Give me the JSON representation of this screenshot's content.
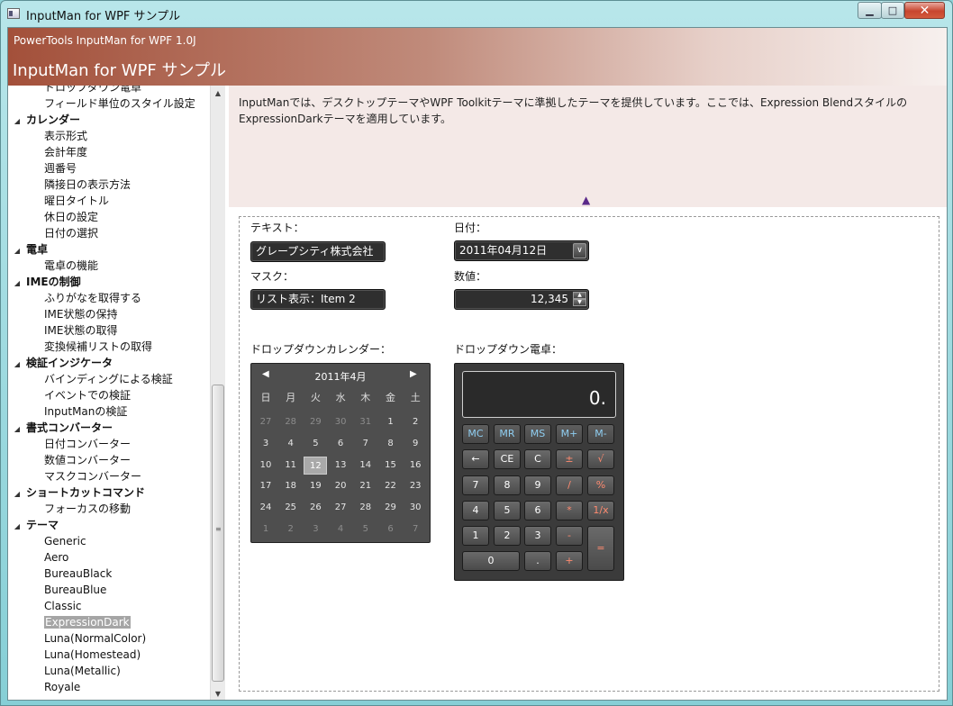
{
  "window": {
    "title": "InputMan for WPF サンプル",
    "minimize_label": "▁",
    "maximize_label": "□",
    "close_label": "✕"
  },
  "header": {
    "subtitle": "PowerTools InputMan for WPF 1.0J",
    "title": "InputMan for WPF サンプル"
  },
  "sidebar": {
    "rows": [
      {
        "label": "ドロップダウン電卓",
        "kind": "item"
      },
      {
        "label": "フィールド単位のスタイル設定",
        "kind": "item"
      },
      {
        "label": "カレンダー",
        "kind": "cat"
      },
      {
        "label": "表示形式",
        "kind": "item"
      },
      {
        "label": "会計年度",
        "kind": "item"
      },
      {
        "label": "週番号",
        "kind": "item"
      },
      {
        "label": "隣接日の表示方法",
        "kind": "item"
      },
      {
        "label": "曜日タイトル",
        "kind": "item"
      },
      {
        "label": "休日の設定",
        "kind": "item"
      },
      {
        "label": "日付の選択",
        "kind": "item"
      },
      {
        "label": "電卓",
        "kind": "cat"
      },
      {
        "label": "電卓の機能",
        "kind": "item"
      },
      {
        "label": "IMEの制御",
        "kind": "cat"
      },
      {
        "label": "ふりがなを取得する",
        "kind": "item"
      },
      {
        "label": "IME状態の保持",
        "kind": "item"
      },
      {
        "label": "IME状態の取得",
        "kind": "item"
      },
      {
        "label": "変換候補リストの取得",
        "kind": "item"
      },
      {
        "label": "検証インジケータ",
        "kind": "cat"
      },
      {
        "label": "バインディングによる検証",
        "kind": "item"
      },
      {
        "label": "イベントでの検証",
        "kind": "item"
      },
      {
        "label": "InputManの検証",
        "kind": "item"
      },
      {
        "label": "書式コンバーター",
        "kind": "cat"
      },
      {
        "label": "日付コンバーター",
        "kind": "item"
      },
      {
        "label": "数値コンバーター",
        "kind": "item"
      },
      {
        "label": "マスクコンバーター",
        "kind": "item"
      },
      {
        "label": "ショートカットコマンド",
        "kind": "cat"
      },
      {
        "label": "フォーカスの移動",
        "kind": "item"
      },
      {
        "label": "テーマ",
        "kind": "cat"
      },
      {
        "label": "Generic",
        "kind": "item"
      },
      {
        "label": "Aero",
        "kind": "item"
      },
      {
        "label": "BureauBlack",
        "kind": "item"
      },
      {
        "label": "BureauBlue",
        "kind": "item"
      },
      {
        "label": "Classic",
        "kind": "item"
      },
      {
        "label": "ExpressionDark",
        "kind": "item",
        "selected": true
      },
      {
        "label": "Luna(NormalColor)",
        "kind": "item"
      },
      {
        "label": "Luna(Homestead)",
        "kind": "item"
      },
      {
        "label": "Luna(Metallic)",
        "kind": "item"
      },
      {
        "label": "Royale",
        "kind": "item"
      }
    ],
    "expand_glyph": "◢",
    "scroll_up": "▲",
    "scroll_down": "▼",
    "grip": "≡"
  },
  "description": {
    "text": "InputManでは、デスクトップテーマやWPF Toolkitテーマに準拠したテーマを提供しています。ここでは、Expression Blendスタイルの ExpressionDarkテーマを適用しています。",
    "collapse_glyph": "▲"
  },
  "demo": {
    "text_label": "テキスト：",
    "text_value": "グレープシティ株式会社",
    "date_label": "日付：",
    "date_value": "2011年04月12日",
    "date_dropdown_glyph": "∨",
    "mask_label": "マスク：",
    "mask_value": "リスト表示：Item 2",
    "number_label": "数値：",
    "number_value": "12,345",
    "spin_up": "▲",
    "spin_down": "▼",
    "calendar_label": "ドロップダウンカレンダー：",
    "calculator_label": "ドロップダウン電卓："
  },
  "calendar": {
    "title": "2011年4月",
    "prev_glyph": "◀",
    "next_glyph": "▶",
    "weekdays": [
      "日",
      "月",
      "火",
      "水",
      "木",
      "金",
      "土"
    ],
    "weeks": [
      [
        "27",
        "28",
        "29",
        "30",
        "31",
        "1",
        "2"
      ],
      [
        "3",
        "4",
        "5",
        "6",
        "7",
        "8",
        "9"
      ],
      [
        "10",
        "11",
        "12",
        "13",
        "14",
        "15",
        "16"
      ],
      [
        "17",
        "18",
        "19",
        "20",
        "21",
        "22",
        "23"
      ],
      [
        "24",
        "25",
        "26",
        "27",
        "28",
        "29",
        "30"
      ],
      [
        "1",
        "2",
        "3",
        "4",
        "5",
        "6",
        "7"
      ]
    ],
    "today": "12"
  },
  "calculator": {
    "display": "0.",
    "memory_keys": [
      "MC",
      "MR",
      "MS",
      "M+",
      "M-"
    ],
    "keys": {
      "backspace": "←",
      "ce": "CE",
      "c": "C",
      "plusminus": "±",
      "sqrt": "√",
      "k7": "7",
      "k8": "8",
      "k9": "9",
      "divide": "/",
      "percent": "%",
      "k4": "4",
      "k5": "5",
      "k6": "6",
      "multiply": "*",
      "reciprocal": "1/x",
      "k1": "1",
      "k2": "2",
      "k3": "3",
      "minus": "-",
      "equals": "=",
      "k0": "0",
      "dot": ".",
      "plus": "+"
    }
  }
}
